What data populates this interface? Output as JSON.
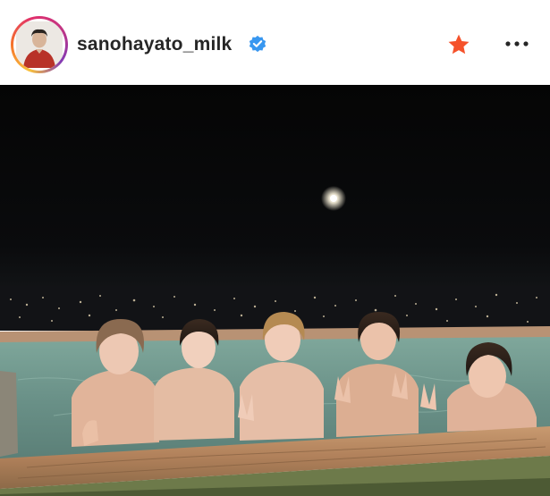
{
  "post": {
    "username": "sanohayato_milk",
    "verified": true,
    "avatar_icon": "profile-avatar",
    "favorite_icon": "star-icon",
    "more_icon": "more-options-icon"
  },
  "colors": {
    "star": "#f5522b",
    "verified": "#3897f0",
    "text": "#262626",
    "night_sky": "#070707",
    "water": "#6f9a90"
  }
}
